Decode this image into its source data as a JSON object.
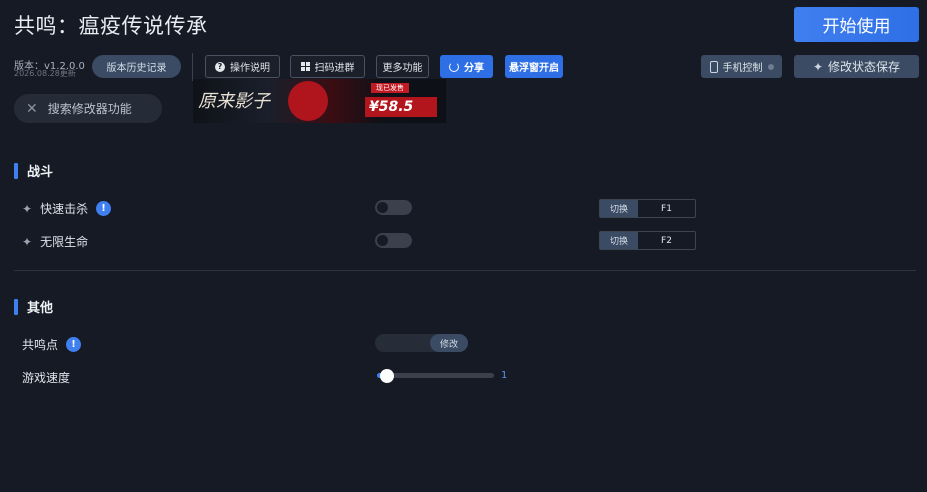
{
  "header": {
    "title": "共鸣：瘟疫传说传承",
    "start_button": "开始使用",
    "version": "版本：v1.2.0.0",
    "update_date": "2026.08.28更新",
    "history_button": "版本历史记录"
  },
  "toolbar": {
    "instructions": "操作说明",
    "scan_group": "扫码进群",
    "more": "更多功能",
    "share": "分享",
    "float_window": "悬浮窗开启",
    "phone_control": "手机控制",
    "save_state": "修改状态保存"
  },
  "search": {
    "placeholder": "搜索修改器功能"
  },
  "banner": {
    "game_text": "原来影子",
    "tag": "现已发售",
    "price": "¥58.5"
  },
  "sections": [
    {
      "title": "战斗",
      "options": [
        {
          "label": "快速击杀",
          "has_info": true,
          "toggle_label": "切换",
          "hotkey": "F1"
        },
        {
          "label": "无限生命",
          "has_info": false,
          "toggle_label": "切换",
          "hotkey": "F2"
        }
      ]
    },
    {
      "title": "其他",
      "options": [
        {
          "label": "共鸣点",
          "has_info": true,
          "action": "修改"
        },
        {
          "label": "游戏速度",
          "value": "1"
        }
      ]
    }
  ],
  "colors": {
    "accent": "#3f7ff0",
    "background": "#161a24"
  }
}
